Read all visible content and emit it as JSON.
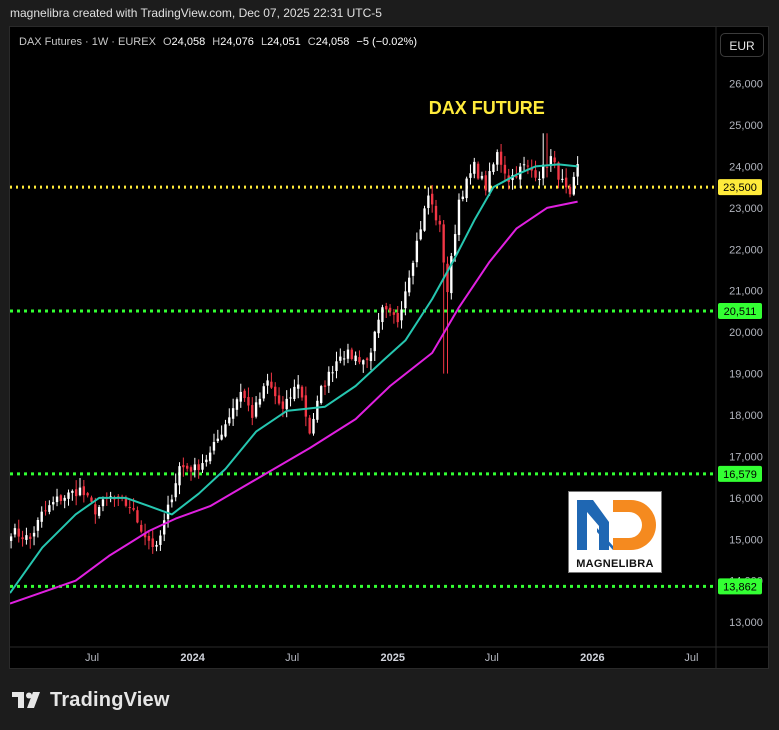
{
  "header": {
    "attribution": "magnelibra created with TradingView.com, Dec 07, 2025 22:31 UTC-5"
  },
  "symbol": {
    "name": "DAX Futures · 1W · EUREX",
    "open_label": "O",
    "open": "24,058",
    "high_label": "H",
    "high": "24,076",
    "low_label": "L",
    "low": "24,051",
    "close_label": "C",
    "close": "24,058",
    "change": "−5 (−0.02%)"
  },
  "currency_button": "EUR",
  "logo": {
    "text": "MAGNELIBRA"
  },
  "footer": {
    "brand": "TradingView"
  },
  "colors": {
    "background": "#000000",
    "up_candle": "#ffffff",
    "down_candle": "#f23645",
    "ma_fast": "#26c6b0",
    "ma_slow": "#e020e0",
    "support_line": "#33ff33",
    "resistance_line": "#ffeb3b",
    "title_text": "#ffeb3b"
  },
  "chart_data": {
    "type": "candlestick",
    "title": "DAX FUTURE",
    "timeframe": "1W",
    "ylim": [
      12400,
      26400
    ],
    "y_ticks": [
      "26,000",
      "25,000",
      "24,000",
      "23,000",
      "22,000",
      "21,000",
      "20,000",
      "19,000",
      "18,000",
      "17,000",
      "16,000",
      "15,000",
      "14,000",
      "13,000"
    ],
    "x_ticks": [
      "Jul",
      "2024",
      "Jul",
      "2025",
      "Jul",
      "2026",
      "Jul"
    ],
    "x_ticks_dates": [
      "2023-07-01",
      "2024-01-01",
      "2024-07-01",
      "2025-01-01",
      "2025-07-01",
      "2026-01-01",
      "2026-07-01"
    ],
    "x_range": [
      "2023-02-01",
      "2026-08-15"
    ],
    "horizontal_lines": [
      {
        "value": 23500,
        "label": "23,500",
        "color": "#ffeb3b"
      },
      {
        "value": 20511,
        "label": "20,511",
        "color": "#33ff33"
      },
      {
        "value": 16579,
        "label": "16,579",
        "color": "#33ff33"
      },
      {
        "value": 13862,
        "label": "13,862",
        "color": "#33ff33"
      }
    ],
    "close_anchors": [
      [
        "2023-02-03",
        15200
      ],
      [
        "2023-03-10",
        15000
      ],
      [
        "2023-03-31",
        15600
      ],
      [
        "2023-04-28",
        15950
      ],
      [
        "2023-06-09",
        16200
      ],
      [
        "2023-07-07",
        15700
      ],
      [
        "2023-08-04",
        16000
      ],
      [
        "2023-09-08",
        15800
      ],
      [
        "2023-10-06",
        15100
      ],
      [
        "2023-10-27",
        14750
      ],
      [
        "2023-11-10",
        15400
      ],
      [
        "2023-12-08",
        16750
      ],
      [
        "2024-01-05",
        16700
      ],
      [
        "2024-02-02",
        17050
      ],
      [
        "2024-03-01",
        17800
      ],
      [
        "2024-03-29",
        18600
      ],
      [
        "2024-04-19",
        18000
      ],
      [
        "2024-05-17",
        18800
      ],
      [
        "2024-06-14",
        18100
      ],
      [
        "2024-07-12",
        18800
      ],
      [
        "2024-08-02",
        17600
      ],
      [
        "2024-08-23",
        18600
      ],
      [
        "2024-09-27",
        19500
      ],
      [
        "2024-10-25",
        19400
      ],
      [
        "2024-11-15",
        19300
      ],
      [
        "2024-12-13",
        20500
      ],
      [
        "2025-01-10",
        20300
      ],
      [
        "2025-02-07",
        21800
      ],
      [
        "2025-03-07",
        23300
      ],
      [
        "2025-03-28",
        22500
      ],
      [
        "2025-04-11",
        21000
      ],
      [
        "2025-05-02",
        23200
      ],
      [
        "2025-05-30",
        24000
      ],
      [
        "2025-06-20",
        23500
      ],
      [
        "2025-07-11",
        24300
      ],
      [
        "2025-08-01",
        23700
      ],
      [
        "2025-08-29",
        24000
      ],
      [
        "2025-09-26",
        23800
      ],
      [
        "2025-10-17",
        24200
      ],
      [
        "2025-11-07",
        23600
      ],
      [
        "2025-11-21",
        23200
      ],
      [
        "2025-12-05",
        24058
      ]
    ],
    "moving_averages": [
      {
        "color": "#26c6b0",
        "points": [
          [
            "2023-02-01",
            13700
          ],
          [
            "2023-04-01",
            14800
          ],
          [
            "2023-06-01",
            15600
          ],
          [
            "2023-07-14",
            16000
          ],
          [
            "2023-09-01",
            16000
          ],
          [
            "2023-10-13",
            15800
          ],
          [
            "2023-11-24",
            15600
          ],
          [
            "2024-01-12",
            16100
          ],
          [
            "2024-03-01",
            16700
          ],
          [
            "2024-04-26",
            17600
          ],
          [
            "2024-06-21",
            18100
          ],
          [
            "2024-08-30",
            18200
          ],
          [
            "2024-10-25",
            18700
          ],
          [
            "2024-12-13",
            19300
          ],
          [
            "2025-01-24",
            19800
          ],
          [
            "2025-03-14",
            20800
          ],
          [
            "2025-04-25",
            21800
          ],
          [
            "2025-05-30",
            22700
          ],
          [
            "2025-07-04",
            23500
          ],
          [
            "2025-08-15",
            23800
          ],
          [
            "2025-09-19",
            24000
          ],
          [
            "2025-10-31",
            24050
          ],
          [
            "2025-12-05",
            24000
          ]
        ]
      },
      {
        "color": "#e020e0",
        "points": [
          [
            "2023-02-01",
            13450
          ],
          [
            "2023-06-01",
            14000
          ],
          [
            "2023-08-01",
            14600
          ],
          [
            "2023-10-13",
            15200
          ],
          [
            "2023-12-01",
            15500
          ],
          [
            "2024-02-02",
            15800
          ],
          [
            "2024-05-03",
            16500
          ],
          [
            "2024-08-02",
            17200
          ],
          [
            "2024-10-25",
            17900
          ],
          [
            "2024-12-27",
            18700
          ],
          [
            "2025-03-14",
            19500
          ],
          [
            "2025-05-02",
            20600
          ],
          [
            "2025-06-27",
            21700
          ],
          [
            "2025-08-15",
            22500
          ],
          [
            "2025-10-10",
            23000
          ],
          [
            "2025-12-05",
            23150
          ]
        ]
      }
    ]
  }
}
